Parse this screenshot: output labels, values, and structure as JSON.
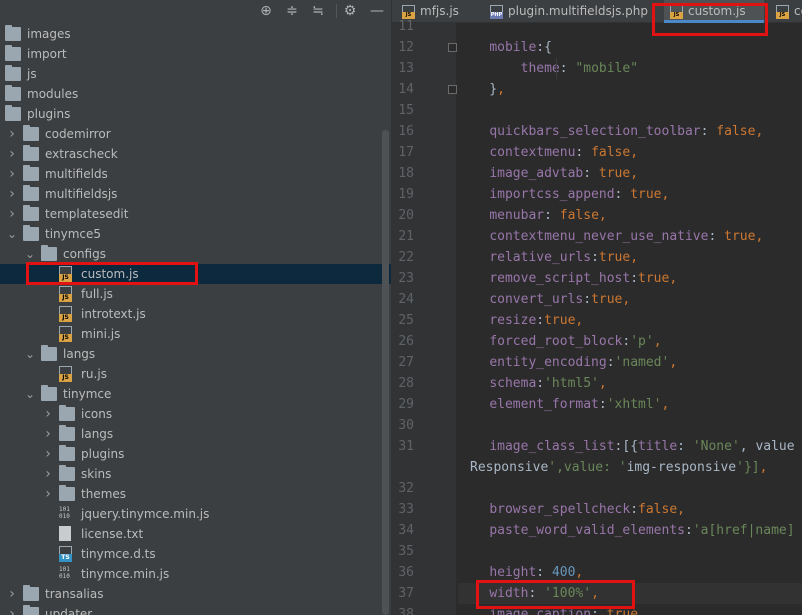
{
  "project_tree": {
    "items": [
      {
        "label": "images",
        "type": "folder",
        "depth": 0,
        "expanded": false
      },
      {
        "label": "import",
        "type": "folder",
        "depth": 0,
        "expanded": false
      },
      {
        "label": "js",
        "type": "folder",
        "depth": 0,
        "expanded": false
      },
      {
        "label": "modules",
        "type": "folder",
        "depth": 0,
        "expanded": false
      },
      {
        "label": "plugins",
        "type": "folder",
        "depth": 0,
        "expanded": true
      },
      {
        "label": "codemirror",
        "type": "folder",
        "depth": 1,
        "expanded": false
      },
      {
        "label": "extrascheck",
        "type": "folder",
        "depth": 1,
        "expanded": false
      },
      {
        "label": "multifields",
        "type": "folder",
        "depth": 1,
        "expanded": false
      },
      {
        "label": "multifieldsjs",
        "type": "folder",
        "depth": 1,
        "expanded": false
      },
      {
        "label": "templatesedit",
        "type": "folder",
        "depth": 1,
        "expanded": false
      },
      {
        "label": "tinymce5",
        "type": "folder",
        "depth": 1,
        "expanded": true
      },
      {
        "label": "configs",
        "type": "folder",
        "depth": 2,
        "expanded": true
      },
      {
        "label": "custom.js",
        "type": "js",
        "depth": 3,
        "selected": true
      },
      {
        "label": "full.js",
        "type": "js",
        "depth": 3
      },
      {
        "label": "introtext.js",
        "type": "js",
        "depth": 3
      },
      {
        "label": "mini.js",
        "type": "js",
        "depth": 3
      },
      {
        "label": "langs",
        "type": "folder",
        "depth": 2,
        "expanded": true
      },
      {
        "label": "ru.js",
        "type": "js",
        "depth": 3
      },
      {
        "label": "tinymce",
        "type": "folder",
        "depth": 2,
        "expanded": true
      },
      {
        "label": "icons",
        "type": "folder",
        "depth": 3,
        "expanded": false
      },
      {
        "label": "langs",
        "type": "folder",
        "depth": 3,
        "expanded": false
      },
      {
        "label": "plugins",
        "type": "folder",
        "depth": 3,
        "expanded": false
      },
      {
        "label": "skins",
        "type": "folder",
        "depth": 3,
        "expanded": false
      },
      {
        "label": "themes",
        "type": "folder",
        "depth": 3,
        "expanded": false
      },
      {
        "label": "jquery.tinymce.min.js",
        "type": "min",
        "depth": 3
      },
      {
        "label": "license.txt",
        "type": "txt",
        "depth": 3
      },
      {
        "label": "tinymce.d.ts",
        "type": "ts",
        "depth": 3
      },
      {
        "label": "tinymce.min.js",
        "type": "min",
        "depth": 3
      },
      {
        "label": "transalias",
        "type": "folder",
        "depth": 1,
        "expanded": false
      },
      {
        "label": "updater",
        "type": "folder",
        "depth": 1,
        "expanded": false
      }
    ]
  },
  "toolbar": {
    "icons": [
      "locate-icon",
      "expand-all-icon",
      "collapse-all-icon",
      "settings-icon",
      "hide-icon"
    ]
  },
  "tabs": [
    {
      "label": "mfjs.js",
      "icon": "JS"
    },
    {
      "label": "plugin.multifieldsjs.php",
      "icon": "PHP"
    },
    {
      "label": "custom.js",
      "icon": "JS",
      "active": true
    },
    {
      "label": "co",
      "icon": "JS"
    }
  ],
  "editor": {
    "lines": [
      {
        "n": "11",
        "code": ""
      },
      {
        "n": "12",
        "code": "    mobile:{"
      },
      {
        "n": "13",
        "code": "        theme: \"mobile\""
      },
      {
        "n": "14",
        "code": "    },"
      },
      {
        "n": "15",
        "code": ""
      },
      {
        "n": "16",
        "code": "    quickbars_selection_toolbar: false,"
      },
      {
        "n": "17",
        "code": "    contextmenu: false,"
      },
      {
        "n": "18",
        "code": "    image_advtab: true,"
      },
      {
        "n": "19",
        "code": "    importcss_append: true,"
      },
      {
        "n": "20",
        "code": "    menubar: false,"
      },
      {
        "n": "21",
        "code": "    contextmenu_never_use_native: true,"
      },
      {
        "n": "22",
        "code": "    relative_urls:true,"
      },
      {
        "n": "23",
        "code": "    remove_script_host:true,"
      },
      {
        "n": "24",
        "code": "    convert_urls:true,"
      },
      {
        "n": "25",
        "code": "    resize:true,"
      },
      {
        "n": "26",
        "code": "    forced_root_block:'p',"
      },
      {
        "n": "27",
        "code": "    entity_encoding:'named',"
      },
      {
        "n": "28",
        "code": "    schema:'html5',"
      },
      {
        "n": "29",
        "code": "    element_format:'xhtml',"
      },
      {
        "n": "30",
        "code": ""
      },
      {
        "n": "31",
        "code": "    image_class_list:[{title: 'None', value"
      },
      {
        "n": "",
        "code": "Responsive',value: 'img-responsive'}],"
      },
      {
        "n": "32",
        "code": ""
      },
      {
        "n": "33",
        "code": "    browser_spellcheck:false,"
      },
      {
        "n": "34",
        "code": "    paste_word_valid_elements:'a[href|name]"
      },
      {
        "n": "35",
        "code": ""
      },
      {
        "n": "36",
        "code": "    height: 400,"
      },
      {
        "n": "37",
        "code": "    width: '100%',"
      },
      {
        "n": "38",
        "code": "    image_caption: true,"
      }
    ]
  },
  "colors": {
    "highlight_box": "#e21212",
    "property": "#9876aa",
    "string": "#6a8759",
    "keyword": "#cc7832",
    "number": "#6897bb"
  }
}
